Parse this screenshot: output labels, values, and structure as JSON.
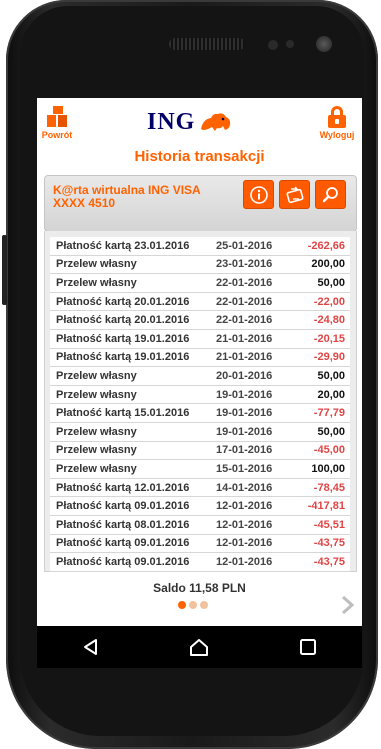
{
  "header": {
    "back_label": "Powrót",
    "logo_text": "ING",
    "logout_label": "Wyloguj",
    "title": "Historia transakcji"
  },
  "card": {
    "name_line1": "K@rta wirtualna ING VISA",
    "name_line2": "XXXX 4510",
    "buttons": [
      {
        "icon": "info-icon"
      },
      {
        "icon": "card-transfer-icon"
      },
      {
        "icon": "search-icon"
      }
    ]
  },
  "transactions": [
    {
      "desc": "Płatność kartą 23.01.2016",
      "date": "25-01-2016",
      "amount": "-262,66",
      "negative": true
    },
    {
      "desc": "Przelew własny",
      "date": "23-01-2016",
      "amount": "200,00",
      "negative": false
    },
    {
      "desc": "Przelew własny",
      "date": "22-01-2016",
      "amount": "50,00",
      "negative": false
    },
    {
      "desc": "Płatność kartą 20.01.2016",
      "date": "22-01-2016",
      "amount": "-22,00",
      "negative": true
    },
    {
      "desc": "Płatność kartą 20.01.2016",
      "date": "22-01-2016",
      "amount": "-24,80",
      "negative": true
    },
    {
      "desc": "Płatność kartą 19.01.2016",
      "date": "21-01-2016",
      "amount": "-20,15",
      "negative": true
    },
    {
      "desc": "Płatność kartą 19.01.2016",
      "date": "21-01-2016",
      "amount": "-29,90",
      "negative": true
    },
    {
      "desc": "Przelew własny",
      "date": "20-01-2016",
      "amount": "50,00",
      "negative": false
    },
    {
      "desc": "Przelew własny",
      "date": "19-01-2016",
      "amount": "20,00",
      "negative": false
    },
    {
      "desc": "Płatność kartą 15.01.2016",
      "date": "19-01-2016",
      "amount": "-77,79",
      "negative": true
    },
    {
      "desc": "Przelew własny",
      "date": "19-01-2016",
      "amount": "50,00",
      "negative": false
    },
    {
      "desc": "Przelew własny",
      "date": "17-01-2016",
      "amount": "-45,00",
      "negative": true
    },
    {
      "desc": "Przelew własny",
      "date": "15-01-2016",
      "amount": "100,00",
      "negative": false
    },
    {
      "desc": "Płatność kartą 12.01.2016",
      "date": "14-01-2016",
      "amount": "-78,45",
      "negative": true
    },
    {
      "desc": "Płatność kartą 09.01.2016",
      "date": "12-01-2016",
      "amount": "-417,81",
      "negative": true
    },
    {
      "desc": "Płatność kartą 08.01.2016",
      "date": "12-01-2016",
      "amount": "-45,51",
      "negative": true
    },
    {
      "desc": "Płatność kartą 09.01.2016",
      "date": "12-01-2016",
      "amount": "-43,75",
      "negative": true
    },
    {
      "desc": "Płatność kartą 09.01.2016",
      "date": "12-01-2016",
      "amount": "-43,75",
      "negative": true
    }
  ],
  "footer": {
    "balance": "Saldo 11,58 PLN",
    "pages": 3,
    "active_page": 1
  },
  "colors": {
    "accent": "#ff6200",
    "negative": "#e04545",
    "brand_blue": "#000066"
  }
}
